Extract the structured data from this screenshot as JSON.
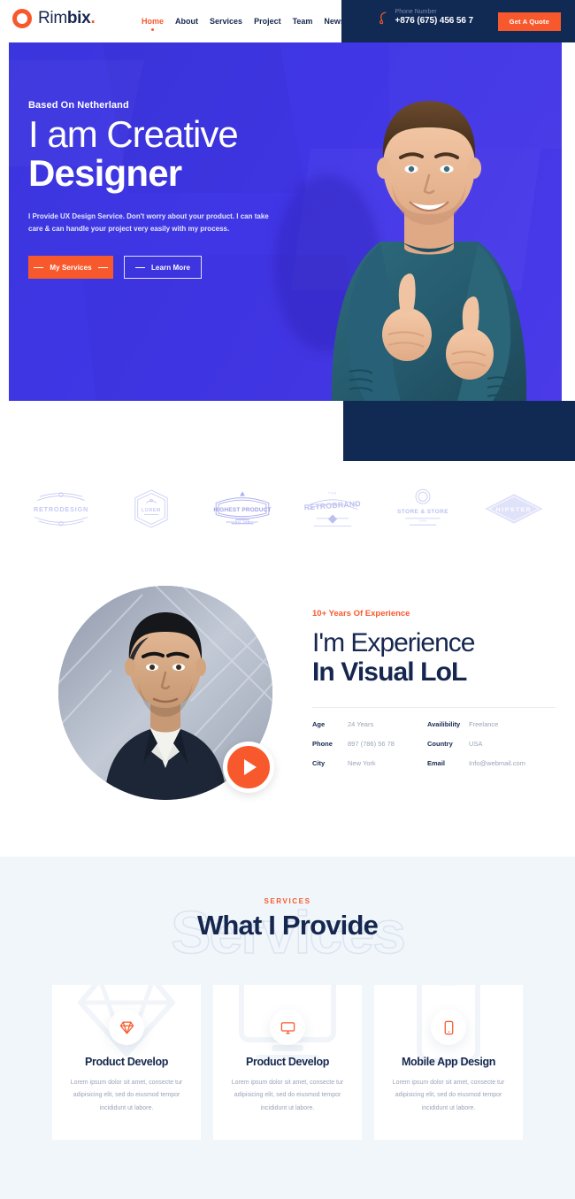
{
  "header": {
    "logo": {
      "part1": "Rim",
      "part2": "bix",
      "dot": ".",
      "icon": "ring-icon"
    },
    "nav": [
      {
        "label": "Home",
        "active": true
      },
      {
        "label": "About",
        "active": false
      },
      {
        "label": "Services",
        "active": false
      },
      {
        "label": "Project",
        "active": false
      },
      {
        "label": "Team",
        "active": false
      },
      {
        "label": "News",
        "active": false
      }
    ],
    "phone": {
      "icon": "phone-icon",
      "label": "Phone Number",
      "number": "+876 (675) 456 56 7"
    },
    "cta": {
      "label": "Get A Quote"
    }
  },
  "hero": {
    "eyebrow": "Based On Netherland",
    "title_light": "I am Creative",
    "title_bold": "Designer",
    "paragraph": "I Provide UX Design Service. Don't worry about your product. I can take care & can handle your project very easily with my process.",
    "buttons": [
      {
        "label": "My Services",
        "style": "primary"
      },
      {
        "label": "Learn More",
        "style": "outline"
      }
    ],
    "photo_alt": "smiling-man-thumbs-up"
  },
  "brands": [
    {
      "name": "RETRODESIGN",
      "sub": ""
    },
    {
      "name": "LOREM",
      "sub": ""
    },
    {
      "name": "HIGHEST PRODUCT",
      "sub": "ORIGINAL COMPANY"
    },
    {
      "name": "RETROBRAND",
      "sub": "THE"
    },
    {
      "name": "STORE & STORE",
      "sub": "1988"
    },
    {
      "name": "HIPSTER",
      "sub": ""
    }
  ],
  "experience": {
    "eyebrow": "10+ Years Of Experience",
    "title_light": "I'm Experience",
    "title_bold": "In Visual LoL",
    "play_button": "play-icon",
    "portrait_alt": "man-in-suit-portrait",
    "info": [
      {
        "key": "Age",
        "value": "24 Years",
        "key2": "Availibility",
        "value2": "Freelance"
      },
      {
        "key": "Phone",
        "value": "897 (786) 56 78",
        "key2": "Country",
        "value2": "USA"
      },
      {
        "key": "City",
        "value": "New York",
        "key2": "Email",
        "value2": "Info@webmail.com"
      }
    ]
  },
  "services": {
    "eyebrow": "SERVICES",
    "title": "What I Provide",
    "watermark": "Services",
    "cards": [
      {
        "icon": "diamond-icon",
        "title": "Product Develop",
        "desc": "Lorem ipsum dolor sit amet, consecte tur adipisicing elit, sed do eiusmod tempor incididunt ut labore."
      },
      {
        "icon": "monitor-icon",
        "title": "Product Develop",
        "desc": "Lorem ipsum dolor sit amet, consecte tur adipisicing elit, sed do eiusmod tempor incididunt ut labore."
      },
      {
        "icon": "mobile-icon",
        "title": "Mobile App Design",
        "desc": "Lorem ipsum dolor sit amet, consecte tur adipisicing elit, sed do eiusmod tempor incididunt ut labore."
      }
    ]
  },
  "colors": {
    "accent": "#f8592c",
    "navy": "#16274f",
    "dark_navy": "#102a54",
    "hero_blue": "#4036e6",
    "services_bg": "#f1f6fa",
    "muted": "#9aa4b8"
  }
}
